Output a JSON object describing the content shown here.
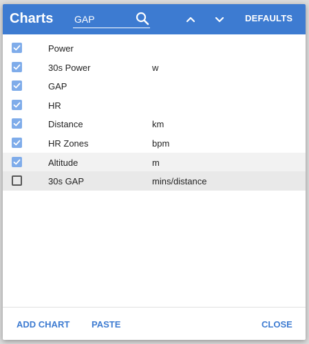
{
  "header": {
    "title": "Charts",
    "search_value": "GAP",
    "search_icon": "search-icon",
    "up_icon": "chevron-up-icon",
    "down_icon": "chevron-down-icon",
    "defaults_label": "DEFAULTS"
  },
  "rows": [
    {
      "name": "Power",
      "unit": "",
      "checked": true
    },
    {
      "name": "30s Power",
      "unit": "w",
      "checked": true
    },
    {
      "name": "GAP",
      "unit": "",
      "checked": true
    },
    {
      "name": "HR",
      "unit": "",
      "checked": true
    },
    {
      "name": "Distance",
      "unit": "km",
      "checked": true
    },
    {
      "name": "HR Zones",
      "unit": "bpm",
      "checked": true
    },
    {
      "name": "Altitude",
      "unit": "m",
      "checked": true
    },
    {
      "name": "30s GAP",
      "unit": "mins/distance",
      "checked": false
    }
  ],
  "footer": {
    "add_chart_label": "ADD CHART",
    "paste_label": "PASTE",
    "close_label": "CLOSE"
  },
  "colors": {
    "header_bg": "#3d7bd1",
    "checkbox_checked": "#7facea",
    "action_text": "#3d7bd1"
  }
}
